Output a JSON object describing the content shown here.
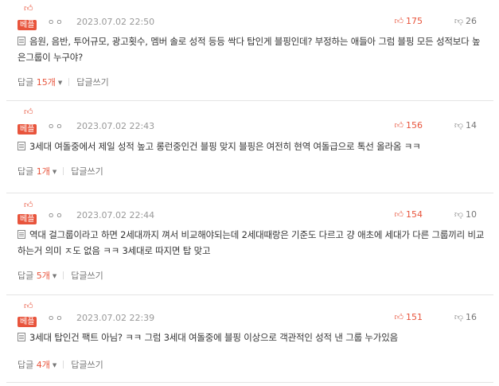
{
  "colors": {
    "accent": "#e8543c",
    "muted": "#999999",
    "divider": "#e4e4e4"
  },
  "comments": [
    {
      "badge": "베플",
      "dots": "ㅇㅇ",
      "date": "2023.07.02 22:50",
      "likes": "175",
      "dislikes": "26",
      "text": "음원, 음반, 투어규모, 광고횟수, 멤버 솔로 성적 등등 싹다 탑인게 블핑인데? 부정하는 애들아 그럼 블핑 모든 성적보다 높은그룹이 누구야?",
      "reply_label": "답글",
      "reply_count": "15개",
      "write_label": "답글쓰기"
    },
    {
      "badge": "베플",
      "dots": "ㅇㅇ",
      "date": "2023.07.02 22:43",
      "likes": "156",
      "dislikes": "14",
      "text": "3세대 여돌중에서 제일 성적 높고 롱런중인건 블핑 맞지 블핑은 여전히 현역 여돌급으로 톡선 올라옴 ㅋㅋ",
      "reply_label": "답글",
      "reply_count": "1개",
      "write_label": "답글쓰기"
    },
    {
      "badge": "베플",
      "dots": "ㅇㅇ",
      "date": "2023.07.02 22:44",
      "likes": "154",
      "dislikes": "10",
      "text": "역대 걸그룹이라고 하면 2세대까지 껴서 비교해야되는데 2세대때랑은 기준도 다르고 걍 애초에 세대가 다른 그룹끼리 비교하는거 의미 ㅈ도 없음 ㅋㅋ 3세대로 따지면 탑 맞고",
      "reply_label": "답글",
      "reply_count": "5개",
      "write_label": "답글쓰기"
    },
    {
      "badge": "베플",
      "dots": "ㅇㅇ",
      "date": "2023.07.02 22:39",
      "likes": "151",
      "dislikes": "16",
      "text": "3세대 탑인건 팩트 아님? ㅋㅋ 그럼 3세대 여돌중에 블핑 이상으로 객관적인 성적 낸 그룹 누가있음",
      "reply_label": "답글",
      "reply_count": "4개",
      "write_label": "답글쓰기"
    }
  ]
}
